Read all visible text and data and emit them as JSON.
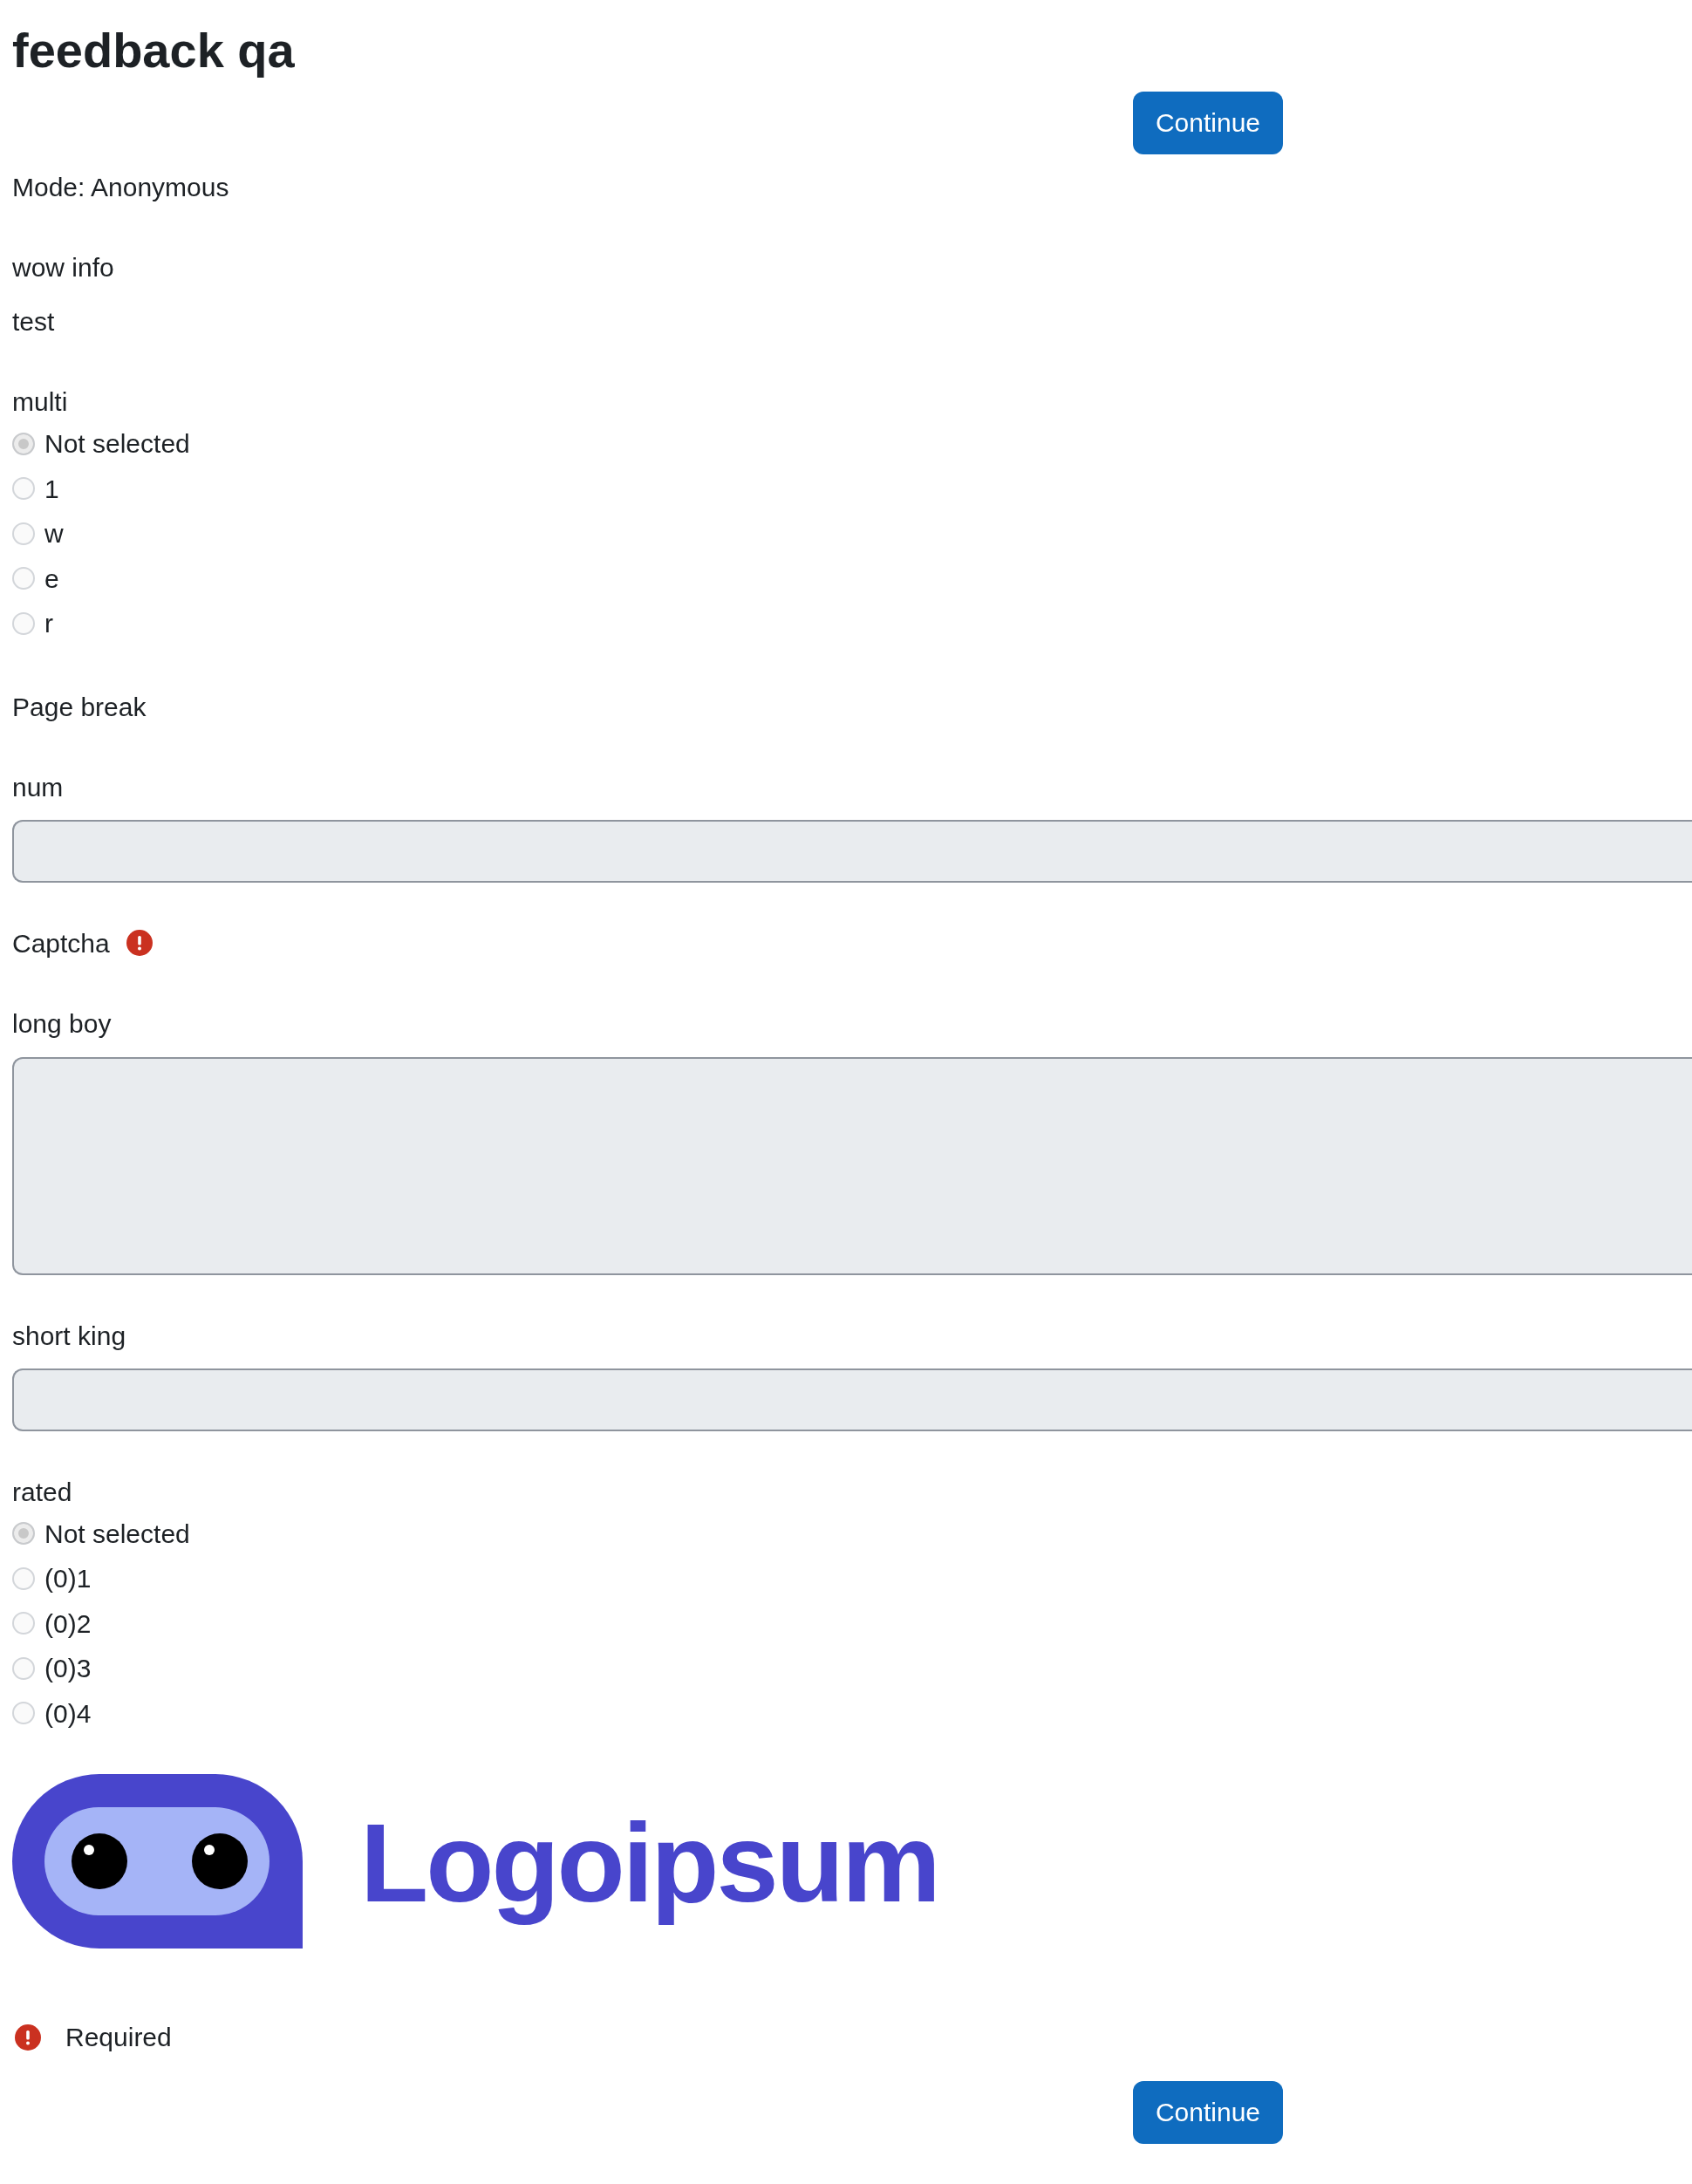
{
  "page": {
    "title": "feedback qa",
    "top_button": {
      "label": "Continue"
    },
    "mode": "Mode: Anonymous"
  },
  "items": [
    {
      "kind": "info",
      "label": "wow info",
      "text": "test"
    },
    {
      "kind": "radio_group",
      "label": "multi",
      "options": [
        {
          "label": "Not selected",
          "selected": true
        },
        {
          "label": "1",
          "selected": false
        },
        {
          "label": "w",
          "selected": false
        },
        {
          "label": "e",
          "selected": false
        },
        {
          "label": "r",
          "selected": false
        }
      ]
    },
    {
      "kind": "pagebreak",
      "label": "Page break"
    },
    {
      "kind": "input",
      "label": "num"
    },
    {
      "kind": "captcha",
      "label": "Captcha",
      "required": true
    },
    {
      "kind": "textarea",
      "label": "long boy"
    },
    {
      "kind": "input",
      "label": "short king"
    },
    {
      "kind": "radio_group",
      "label": "rated",
      "options": [
        {
          "label": "Not selected",
          "selected": true
        },
        {
          "label": "(0)1",
          "selected": false
        },
        {
          "label": "(0)2",
          "selected": false
        },
        {
          "label": "(0)3",
          "selected": false
        },
        {
          "label": "(0)4",
          "selected": false
        }
      ]
    },
    {
      "kind": "logo",
      "text": "Logoipsum"
    }
  ],
  "footer": {
    "required_note": "Required",
    "button": {
      "label": "Continue"
    }
  }
}
